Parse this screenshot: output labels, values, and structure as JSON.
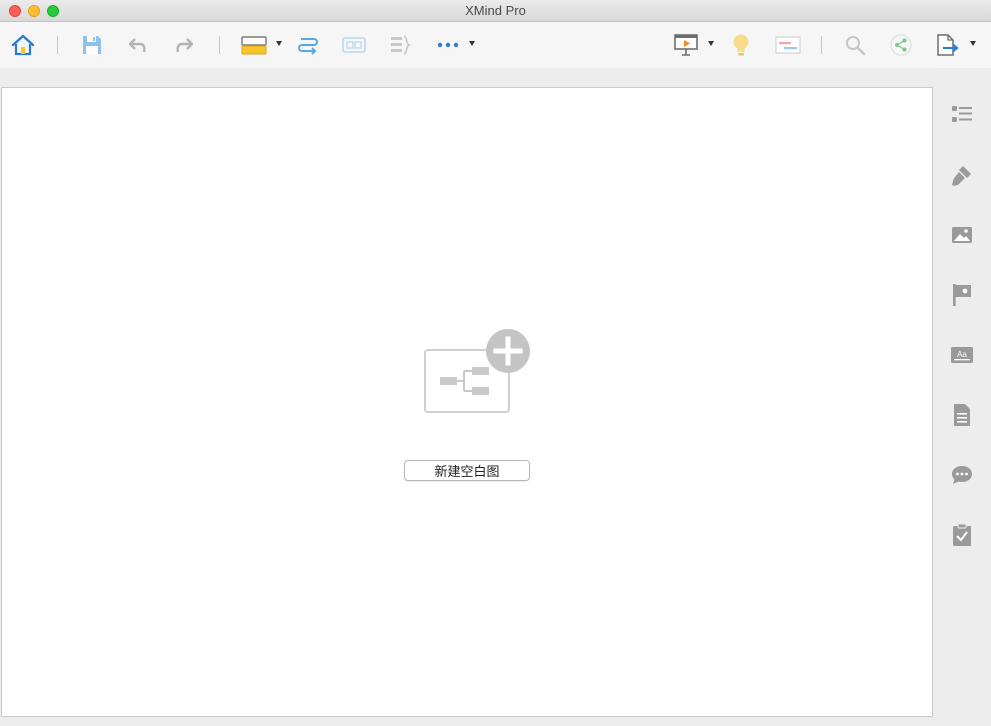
{
  "window": {
    "title": "XMind Pro"
  },
  "toolbar": {
    "items": [
      {
        "name": "home-icon"
      },
      {
        "name": "save-icon"
      },
      {
        "name": "undo-icon"
      },
      {
        "name": "redo-icon"
      },
      {
        "name": "topic-icon"
      },
      {
        "name": "relationship-icon"
      },
      {
        "name": "boundary-icon"
      },
      {
        "name": "summary-icon"
      },
      {
        "name": "more-icon"
      },
      {
        "name": "presentation-icon"
      },
      {
        "name": "idea-icon"
      },
      {
        "name": "gantt-icon"
      },
      {
        "name": "search-icon"
      },
      {
        "name": "share-icon"
      },
      {
        "name": "export-icon"
      }
    ]
  },
  "sidebar": {
    "items": [
      {
        "name": "outliner-icon"
      },
      {
        "name": "format-icon"
      },
      {
        "name": "image-icon"
      },
      {
        "name": "marker-icon"
      },
      {
        "name": "text-style-icon"
      },
      {
        "name": "notes-icon"
      },
      {
        "name": "comments-icon"
      },
      {
        "name": "task-icon"
      }
    ]
  },
  "canvas": {
    "new_blank_map_label": "新建空白图"
  },
  "colors": {
    "accent": "#2b7bd6",
    "highlight": "#f7c52c",
    "icon_gray": "#8a8a8a"
  }
}
